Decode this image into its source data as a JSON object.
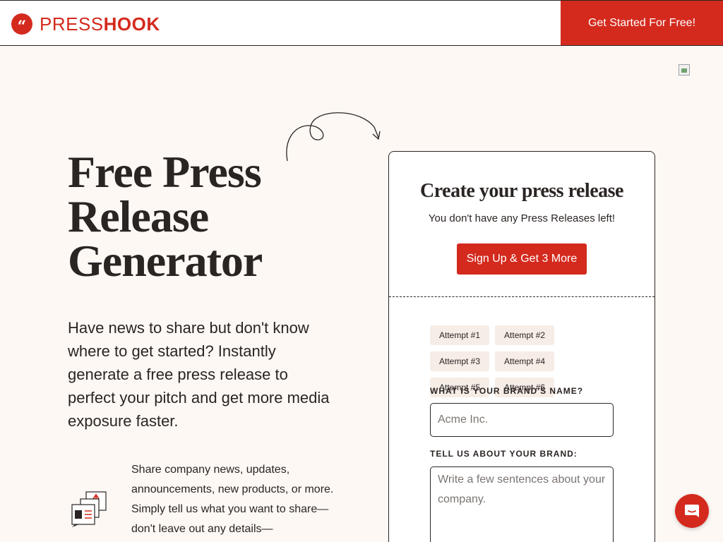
{
  "header": {
    "logo_part1": "PRESS",
    "logo_part2": "HOOK",
    "logo_icon": "quote-mark-icon",
    "cta_label": "Get Started For Free!"
  },
  "hero": {
    "title_lines": [
      "Free Press",
      "Release",
      "Generator"
    ],
    "description": "Have news to share but don't know where to get started? Instantly generate a free press release to perfect your pitch and get more media exposure faster."
  },
  "feature": {
    "icon": "press-release-document-icon",
    "text": "Share company news, updates, announcements, new products, or more. Simply tell us what you want to share—don't leave out any details—"
  },
  "card": {
    "title": "Create your press release",
    "subtitle": "You don't have any Press Releases left!",
    "cta_label": "Sign Up & Get 3 More",
    "attempts": [
      "Attempt #1",
      "Attempt #2",
      "Attempt #3",
      "Attempt #4",
      "Attempt #5",
      "Attempt #6"
    ],
    "brand_name": {
      "label": "WHAT IS YOUR BRAND'S NAME?",
      "placeholder": "Acme Inc.",
      "value": ""
    },
    "brand_about": {
      "label": "TELL US ABOUT YOUR BRAND:",
      "placeholder": "Write a few sentences about your company.",
      "value": ""
    }
  },
  "chat": {
    "icon": "chat-bubble-icon"
  },
  "colors": {
    "brand_red": "#d42a1e",
    "background": "#fdf8f4",
    "chip_bg": "#f6ede6",
    "text": "#2a2523"
  }
}
